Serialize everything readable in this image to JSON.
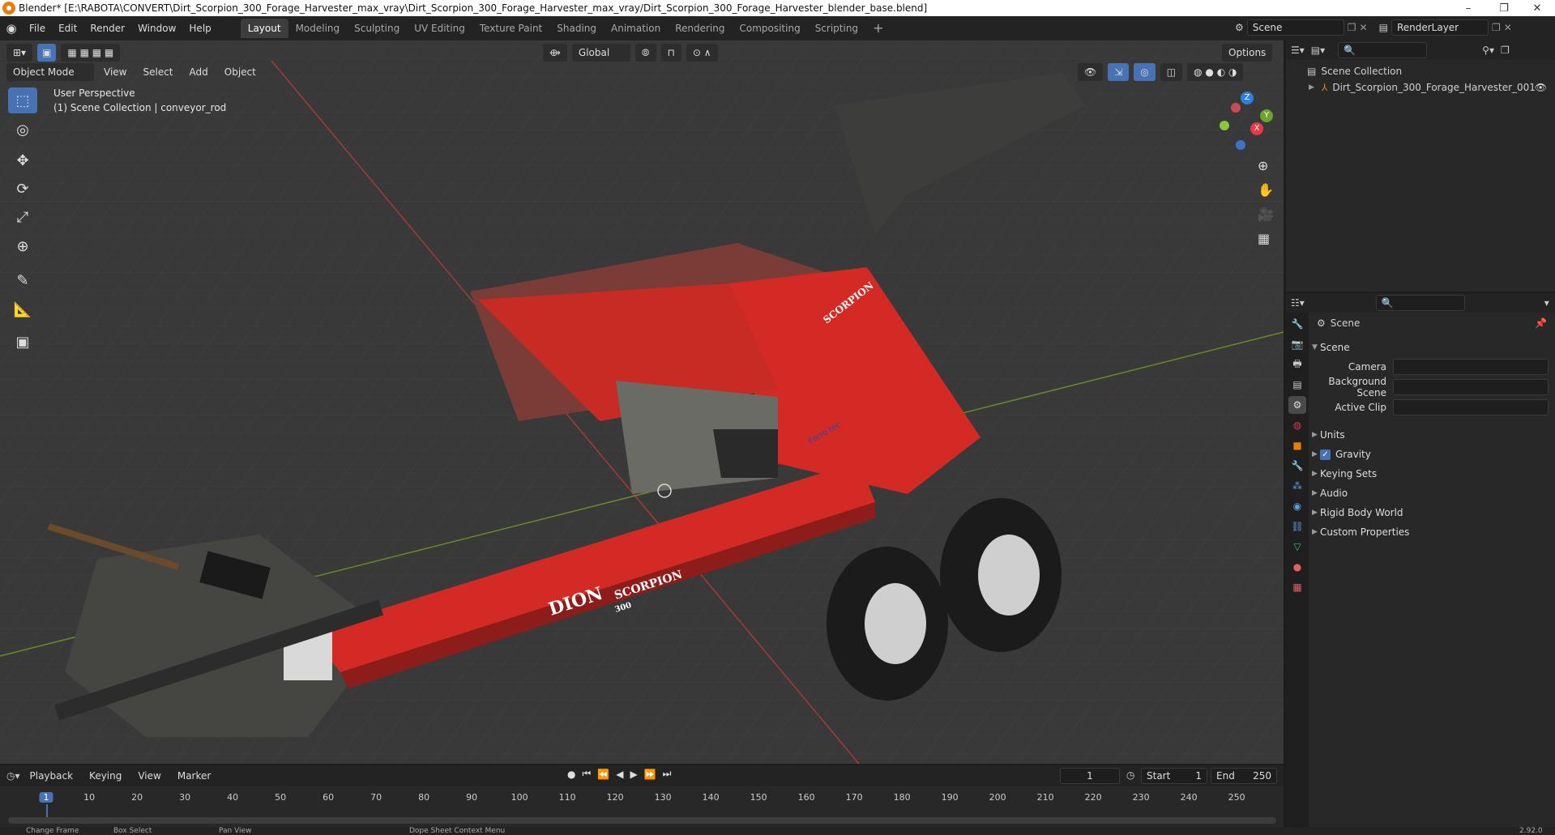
{
  "window": {
    "title": "Blender* [E:\\RABOTA\\CONVERT\\Dirt_Scorpion_300_Forage_Harvester_max_vray\\Dirt_Scorpion_300_Forage_Harvester_max_vray/Dirt_Scorpion_300_Forage_Harvester_blender_base.blend]"
  },
  "menu": {
    "items": [
      "File",
      "Edit",
      "Render",
      "Window",
      "Help"
    ]
  },
  "workspaces": [
    "Layout",
    "Modeling",
    "Sculpting",
    "UV Editing",
    "Texture Paint",
    "Shading",
    "Animation",
    "Rendering",
    "Compositing",
    "Scripting"
  ],
  "active_workspace": "Layout",
  "scene_name": "Scene",
  "render_layer": "RenderLayer",
  "viewport": {
    "mode": "Object Mode",
    "menu": [
      "View",
      "Select",
      "Add",
      "Object"
    ],
    "orientation": "Global",
    "options": "Options",
    "perspective_label": "User Perspective",
    "collection_label": "(1) Scene Collection | conveyor_rod",
    "model": {
      "brand": "DION",
      "model_name": "SCORPION",
      "model_number": "300",
      "side_brand": "Ferro tec"
    },
    "gizmo": {
      "z": "Z",
      "y": "Y",
      "x": "X"
    }
  },
  "outliner": {
    "root": "Scene Collection",
    "items": [
      "Dirt_Scorpion_300_Forage_Harvester_001"
    ]
  },
  "properties": {
    "context": "Scene",
    "section": "Scene",
    "fields": [
      {
        "label": "Camera"
      },
      {
        "label": "Background Scene"
      },
      {
        "label": "Active Clip"
      }
    ],
    "subsections": [
      "Units",
      "Gravity",
      "Keying Sets",
      "Audio",
      "Rigid Body World",
      "Custom Properties"
    ],
    "gravity_checked": true
  },
  "timeline": {
    "menu": [
      "Playback",
      "Keying",
      "View",
      "Marker"
    ],
    "current_frame": "1",
    "start_label": "Start",
    "start": "1",
    "end_label": "End",
    "end": "250",
    "ticks": [
      "1",
      "10",
      "20",
      "30",
      "40",
      "50",
      "60",
      "70",
      "80",
      "90",
      "100",
      "110",
      "120",
      "130",
      "140",
      "150",
      "160",
      "170",
      "180",
      "190",
      "200",
      "210",
      "220",
      "230",
      "240",
      "250"
    ]
  },
  "statusbar": {
    "items": [
      "Change Frame",
      "Box Select",
      "Pan View",
      "Dope Sheet Context Menu"
    ],
    "version": "2.92.0"
  },
  "colors": {
    "accent": "#4772b3",
    "body_red": "#d42a25",
    "header": "#232323",
    "panel": "#282828",
    "viewport": "#3a3a3a"
  }
}
